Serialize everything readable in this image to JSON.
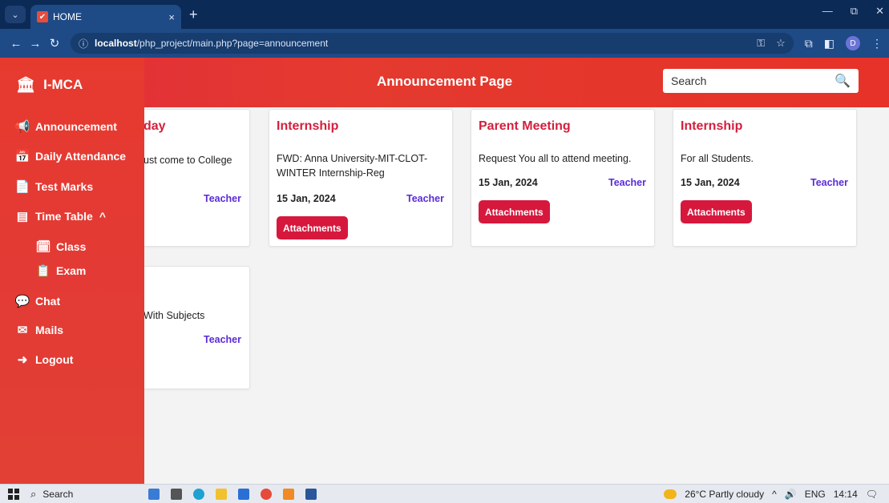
{
  "browser": {
    "tab_title": "HOME",
    "tab_close": "×",
    "new_tab": "+",
    "window_controls": [
      "—",
      "⧉",
      "✕"
    ],
    "url_host": "localhost",
    "url_path": "/php_project/main.php?page=announcement",
    "profile_initial": "D"
  },
  "app": {
    "brand": "I-MCA",
    "page_title": "Announcement Page",
    "search_placeholder": "Search"
  },
  "sidebar": {
    "items": [
      {
        "label": "Announcement",
        "icon": "megaphone-icon",
        "glyph": "📢"
      },
      {
        "label": "Daily Attendance",
        "icon": "calendar-check-icon",
        "glyph": "📅"
      },
      {
        "label": "Test Marks",
        "icon": "file-icon",
        "glyph": "📄"
      },
      {
        "label": "Time Table",
        "icon": "list-icon",
        "glyph": "▤",
        "chevron": "^"
      },
      {
        "label": "Class",
        "icon": "calendar-day-icon",
        "glyph": "🗓"
      },
      {
        "label": "Exam",
        "icon": "clipboard-icon",
        "glyph": "📋"
      },
      {
        "label": "Chat",
        "icon": "comments-icon",
        "glyph": "💬"
      },
      {
        "label": "Mails",
        "icon": "mail-bulk-icon",
        "glyph": "✉"
      },
      {
        "label": "Logout",
        "icon": "sign-out-icon",
        "glyph": "➜"
      }
    ]
  },
  "cards": [
    {
      "title": "day",
      "desc": "ust come to College",
      "date": "",
      "author": "Teacher",
      "attach": ""
    },
    {
      "title": "Internship",
      "desc": "FWD: Anna University-MIT-CLOT-WINTER Internship-Reg",
      "date": "15 Jan, 2024",
      "author": "Teacher",
      "attach": "Attachments"
    },
    {
      "title": "Parent Meeting",
      "desc": "Request You all to attend meeting.",
      "date": "15 Jan, 2024",
      "author": "Teacher",
      "attach": "Attachments"
    },
    {
      "title": "Internship",
      "desc": "For all Students.",
      "date": "15 Jan, 2024",
      "author": "Teacher",
      "attach": "Attachments"
    },
    {
      "title": "",
      "desc": "With Subjects",
      "date": "",
      "author": "Teacher",
      "attach": ""
    }
  ],
  "taskbar": {
    "search_label": "Search",
    "weather": "26°C  Partly cloudy",
    "lang": "ENG",
    "time": "14:14"
  }
}
